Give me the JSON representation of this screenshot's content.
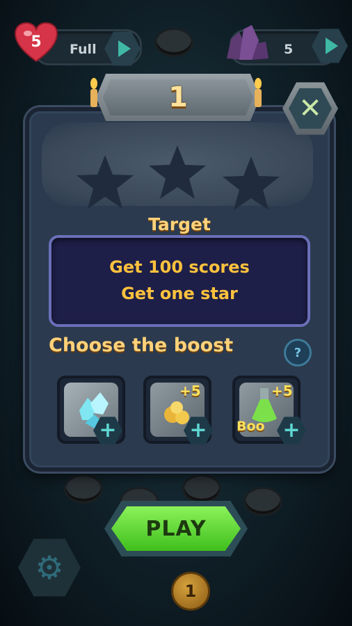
{
  "hud": {
    "lives_count": "5",
    "lives_status": "Full",
    "gems_count": "5"
  },
  "dialog": {
    "level_number": "1",
    "stars_earned": 0,
    "stars_total": 3,
    "target_title": "Target",
    "target_lines": [
      "Get 100 scores",
      "Get one star"
    ],
    "boost_title": "Choose the boost",
    "help_label": "?",
    "boosts": [
      {
        "icon": "crystal-boost-icon",
        "badge": ""
      },
      {
        "icon": "gold-nugget-boost-icon",
        "badge": "+5"
      },
      {
        "icon": "potion-boost-icon",
        "badge": "+5",
        "label": "Boo"
      }
    ],
    "add_label": "+",
    "close_label": "✕"
  },
  "play": {
    "label": "PLAY"
  },
  "map": {
    "current_level_coin": "1"
  },
  "colors": {
    "title_gold": "#ffd27a",
    "target_text": "#ffc23d",
    "play_green": "#6ee23d",
    "panel": "#2b3a4e"
  }
}
